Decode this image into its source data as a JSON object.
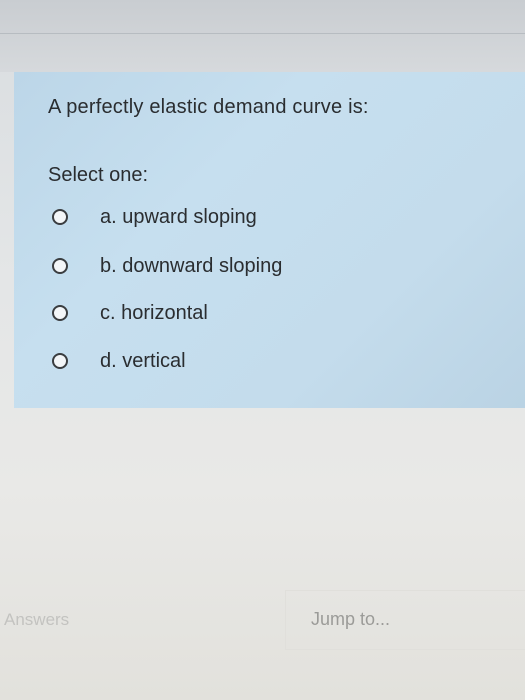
{
  "question": {
    "text": "A perfectly elastic demand curve is:",
    "prompt": "Select one:",
    "options": [
      {
        "label": "a. upward sloping"
      },
      {
        "label": "b. downward sloping"
      },
      {
        "label": "c. horizontal"
      },
      {
        "label": "d. vertical"
      }
    ]
  },
  "footer": {
    "answers_label": "Answers",
    "jump_label": "Jump to..."
  },
  "colors": {
    "card_background": "#c4dcec",
    "text": "#2a2d30"
  }
}
